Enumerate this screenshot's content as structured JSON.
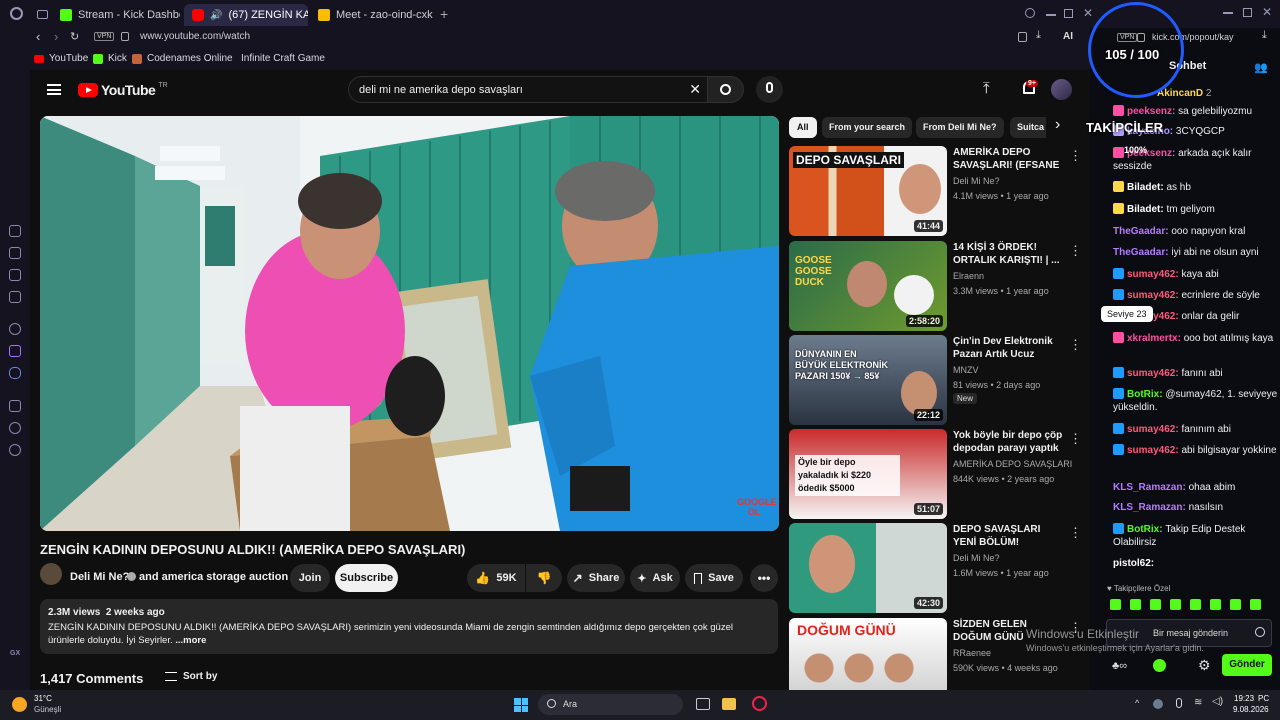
{
  "browser": {
    "tabs": [
      {
        "label": "Stream - Kick Dashboard",
        "color": "#53fc18"
      },
      {
        "label": "(67) ZENGİN KADININ D",
        "color": "#ff0000"
      },
      {
        "label": "Meet - zao-oind-cxk",
        "color": "#fbbc04"
      }
    ],
    "vpn": "VPN",
    "url": "www.youtube.com/watch",
    "ai_label": "AI",
    "bookmarks": [
      "YouTube",
      "Kick",
      "Codenames Online",
      "Infinite Craft Game"
    ]
  },
  "youtube": {
    "logo": "YouTube",
    "region": "TR",
    "search_query": "deli mi ne amerika depo savaşları",
    "notif_count": "9+",
    "chips": [
      "All",
      "From your search",
      "From Deli Mi Ne?",
      "Suitca"
    ],
    "video": {
      "title": "ZENGİN KADININ DEPOSUNU ALDIK!! (AMERİKA DEPO SAVAŞLARI)",
      "channel": "Deli Mi Ne?",
      "collab": "and america storage auction",
      "join": "Join",
      "subscribe": "Subscribe",
      "likes": "59K",
      "share": "Share",
      "ask": "Ask",
      "save": "Save",
      "views": "2.3M views",
      "age": "2 weeks ago",
      "description": "ZENGİN KADININ DEPOSUNU ALDIK!! (AMERİKA DEPO SAVAŞLARI) serimizin yeni videosunda Miami de zengin semtinden aldığımız depo gerçekten çok güzel ürünlerle doluydu. İyi Seyirler.",
      "more": "...more",
      "watermark": "GOOGLE OL",
      "comments": "1,417 Comments",
      "sort": "Sort by"
    },
    "recommendations": [
      {
        "title": "AMERİKA DEPO SAVAŞLARI! (EFSANE ...",
        "channel": "Deli Mi Ne?",
        "meta": "4.1M views • 1 year ago",
        "duration": "41:44",
        "thumb_text": "DEPO SAVAŞLARI",
        "badge": ""
      },
      {
        "title": "14 KİŞİ 3 ÖRDEK! ORTALIK KARIŞTI! | ...",
        "channel": "Elraenn",
        "meta": "3.3M views • 1 year ago",
        "duration": "2:58:20",
        "thumb_text": "GOOSE GOOSE DUCK",
        "badge": ""
      },
      {
        "title": "Çin'in Dev Elektronik Pazarı Artık Ucuz Değil! ...",
        "channel": "MNZV",
        "meta": "81 views • 2 days ago",
        "duration": "22:12",
        "thumb_text": "DÜNYANIN EN BÜYÜK ELEKTRONİK PAZARI 150¥ → 85¥",
        "badge": "New"
      },
      {
        "title": "Yok böyle bir depo çöp depodan parayı yaptık",
        "channel": "AMERİKA DEPO SAVAŞLARI",
        "meta": "844K views • 2 years ago",
        "duration": "51:07",
        "thumb_text": "Öyle bir depo yakaladık ki $220 ödedik $5000",
        "badge": ""
      },
      {
        "title": "DEPO SAVAŞLARI YENİ BÖLÜM! (STRİPTİZCİ ...",
        "channel": "Deli Mi Ne?",
        "meta": "1.6M views • 1 year ago",
        "duration": "42:30",
        "thumb_text": "",
        "badge": ""
      },
      {
        "title": "SİZDEN GELEN DOĞUM GÜNÜ HEDİYELERİNİ ...",
        "channel": "RRaenee",
        "meta": "590K views • 4 weeks ago",
        "duration": "",
        "thumb_text": "DOĞUM GÜNÜ",
        "badge": ""
      }
    ]
  },
  "overlay": {
    "counter": "105 / 100",
    "followers": "TAKİPÇİLER",
    "percent": "100%",
    "tooltip": "Seviye 23",
    "win_activate_1": "Windows'u Etkinleştir",
    "win_activate_2": "Windows'u etkinleştirmek için Ayarlar'a gidin."
  },
  "kick": {
    "url": "kick.com/popout/kay",
    "chat_title": "Sohbet",
    "top_user": "AkincanD",
    "top_user_count": "2",
    "messages": [
      {
        "user": "peeksenz",
        "color": "#ff4fa3",
        "text": "sa gelebiliyozmu"
      },
      {
        "user": "kayacino",
        "color": "#b39cff",
        "text": "3CYQGCP"
      },
      {
        "user": "peeksenz",
        "color": "#ff4fa3",
        "text": "arkada açık kalır sessizde"
      },
      {
        "user": "Biladet",
        "color": "#ffffff",
        "text": "as hb"
      },
      {
        "user": "Biladet",
        "color": "#ffffff",
        "text": "tm geliyom"
      },
      {
        "user": "TheGaadar",
        "color": "#b47cff",
        "text": "ooo napıyon kral"
      },
      {
        "user": "TheGaadar",
        "color": "#b47cff",
        "text": "iyi abi ne olsun ayni"
      },
      {
        "user": "sumay462",
        "color": "#ff5a7a",
        "text": "kaya abi"
      },
      {
        "user": "sumay462",
        "color": "#ff5a7a",
        "text": "ecrinlere de söyle"
      },
      {
        "user": "sumay462",
        "color": "#ff5a7a",
        "text": "onlar da gelir"
      },
      {
        "user": "xkralmertx",
        "color": "#ff4fa3",
        "text": "ooo bot atılmış kaya"
      },
      {
        "user": "sumay462",
        "color": "#ff5a7a",
        "text": "fanını abi"
      },
      {
        "user": "BotRix",
        "color": "#53fc18",
        "text": "@sumay462, 1. seviyeye yükseldin."
      },
      {
        "user": "sumay462",
        "color": "#ff5a7a",
        "text": "fanınım abi"
      },
      {
        "user": "sumay462",
        "color": "#ff5a7a",
        "text": "abi bilgisayar yokkine"
      },
      {
        "user": "KLS_Ramazan",
        "color": "#b47cff",
        "text": "ohaa abim"
      },
      {
        "user": "KLS_Ramazan",
        "color": "#b47cff",
        "text": "nasılsın"
      },
      {
        "user": "BotRix",
        "color": "#53fc18",
        "text": "Takip Edip Destek Olabilirsiz"
      },
      {
        "user": "pistol62",
        "color": "#ffffff",
        "text": ""
      }
    ],
    "followers_only": "Takipçilere Özel",
    "input_placeholder": "Bir mesaj gönderin",
    "send": "Gönder"
  },
  "taskbar": {
    "temp": "31°C",
    "weather": "Güneşli",
    "search": "Ara",
    "time": "19:23",
    "date": "9.08.2026",
    "pc": "PC"
  }
}
